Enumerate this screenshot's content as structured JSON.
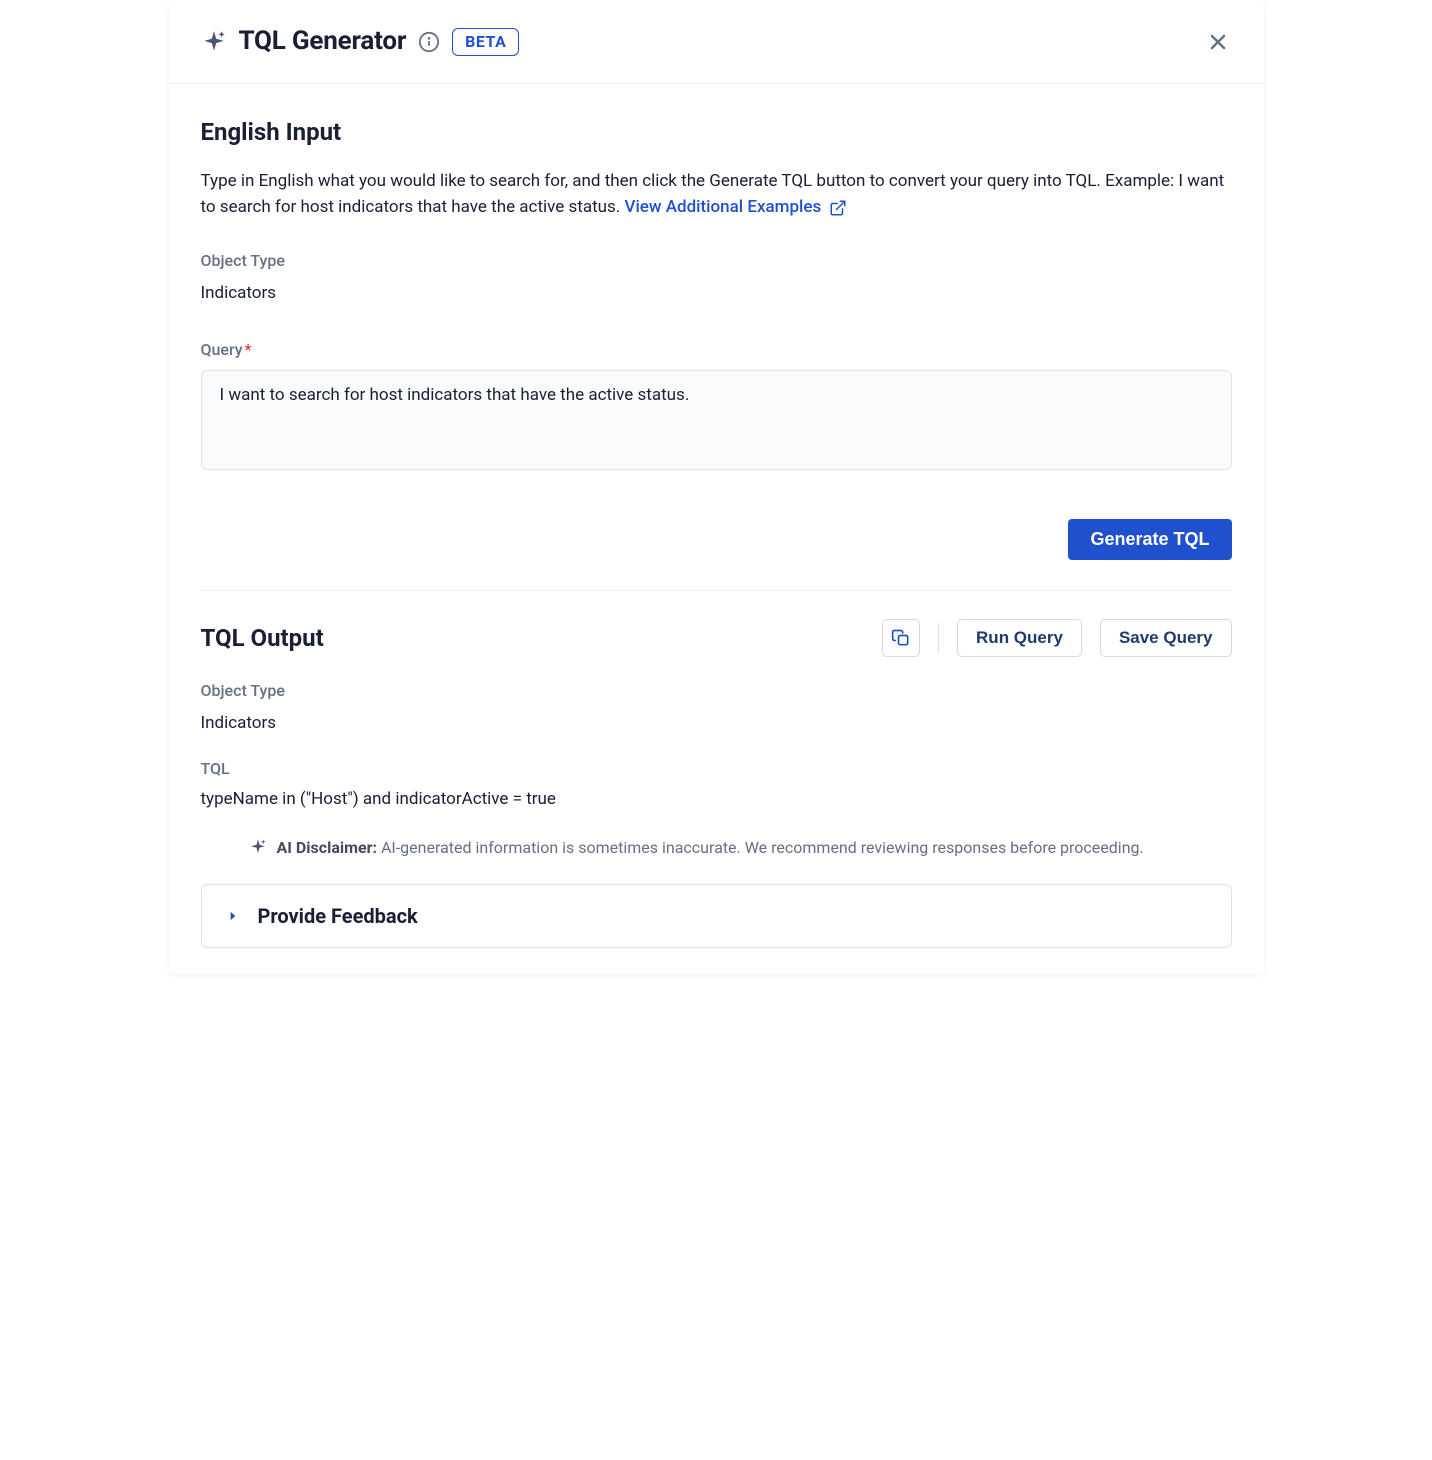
{
  "header": {
    "title": "TQL Generator",
    "badge": "BETA"
  },
  "input_section": {
    "title": "English Input",
    "description": "Type in English what you would like to search for, and then click the Generate TQL button to convert your query into TQL. Example: I want to search for host indicators that have the active status. ",
    "link_text": "View Additional Examples",
    "object_type_label": "Object Type",
    "object_type_value": "Indicators",
    "query_label": "Query",
    "query_value": "I want to search for host indicators that have the active status.",
    "generate_button": "Generate TQL"
  },
  "output_section": {
    "title": "TQL Output",
    "run_button": "Run Query",
    "save_button": "Save Query",
    "object_type_label": "Object Type",
    "object_type_value": "Indicators",
    "tql_label": "TQL",
    "tql_value": "typeName in (\"Host\") and indicatorActive = true",
    "disclaimer_bold": "AI Disclaimer:",
    "disclaimer_text": " AI-generated information is sometimes inaccurate. We recommend reviewing responses before proceeding.",
    "feedback_label": "Provide Feedback"
  }
}
